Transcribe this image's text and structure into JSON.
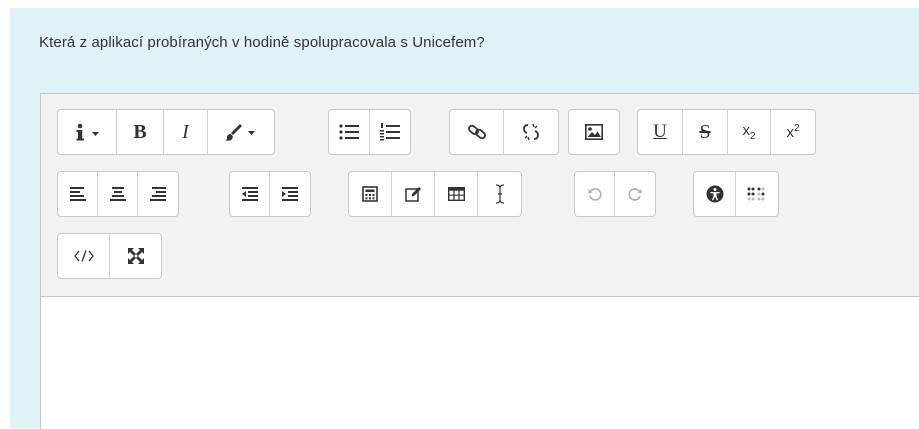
{
  "question": {
    "text": "Která z aplikací probíraných v hodině spolupracovala s Unicefem?"
  },
  "toolbar": {
    "rows": [
      [
        [
          "info-icon",
          "bold-button",
          "italic-button",
          "font-color-icon"
        ],
        [
          "bullet-list-icon",
          "numbered-list-icon"
        ],
        [
          "link-icon",
          "unlink-icon"
        ],
        [
          "image-icon"
        ],
        [
          "underline-button",
          "strikethrough-button",
          "subscript-button",
          "superscript-button"
        ]
      ],
      [
        [
          "align-left-icon",
          "align-center-icon",
          "align-right-icon"
        ],
        [
          "outdent-icon",
          "indent-icon"
        ],
        [
          "equation-icon",
          "edit-icon",
          "table-icon",
          "cursor-icon"
        ],
        [
          "undo-icon",
          "redo-icon"
        ],
        [
          "accessibility-icon",
          "braille-icon"
        ]
      ],
      [
        [
          "code-icon",
          "fullscreen-icon"
        ]
      ]
    ],
    "labels": {
      "bold": "B",
      "italic": "I",
      "underline": "U",
      "strike": "S",
      "sub": "x",
      "sub_idx": "2",
      "sup": "x",
      "sup_idx": "2"
    }
  },
  "colors": {
    "panel_bg": "#def2f8",
    "toolbar_bg": "#f2f2f2",
    "border": "#c6c6c6"
  }
}
